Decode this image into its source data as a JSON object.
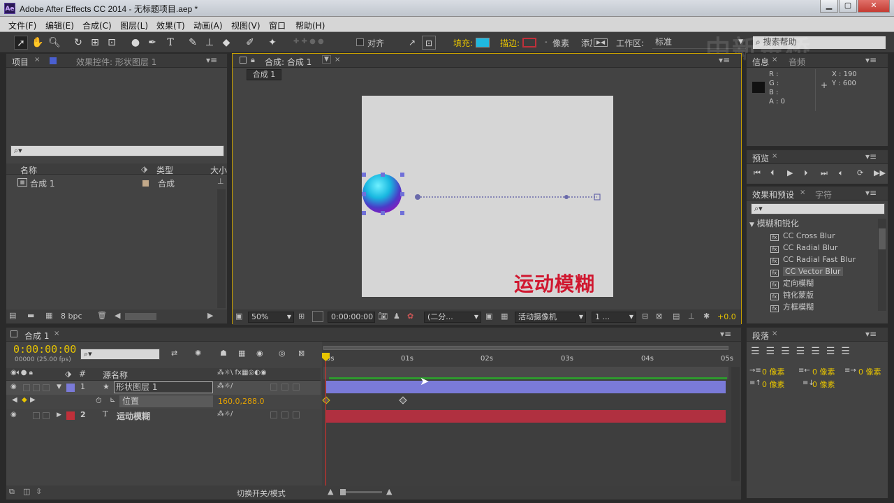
{
  "window": {
    "logo": "Ae",
    "title": "Adobe After Effects CC 2014 - 无标题项目.aep *",
    "min": "▁",
    "max": "▢",
    "close": "✕"
  },
  "menu": [
    "文件(F)",
    "编辑(E)",
    "合成(C)",
    "图层(L)",
    "效果(T)",
    "动画(A)",
    "视图(V)",
    "窗口",
    "帮助(H)"
  ],
  "toolbar": {
    "align_label": "对齐",
    "fill_label": "填充:",
    "stroke_label": "描边:",
    "stroke_unit": "像素",
    "add_label": "添加:",
    "workspace_label": "工作区:",
    "workspace_value": "标准",
    "search_placeholder": "搜索帮助",
    "fill_color": "#1fb8e0",
    "stroke_color": "#c0303a"
  },
  "project_panel": {
    "tab_project": "项目",
    "tab_effect_controls": "效果控件: 形状图层 1",
    "search_placeholder": "⌕▾",
    "col_name": "名称",
    "col_type": "类型",
    "col_size": "大小",
    "items": [
      {
        "name": "合成 1",
        "type": "合成"
      }
    ],
    "bpc": "8 bpc"
  },
  "comp_viewer": {
    "tab_label": "合成: 合成 1",
    "breadcrumb": "合成 1",
    "text_layer": "运动模糊",
    "zoom": "50%",
    "timecode": "0:00:00:00",
    "resolution": "(二分...",
    "camera": "活动摄像机",
    "views": "1 ...",
    "exposure": "+0.0",
    "canvas_color": "#d6d6d6"
  },
  "info_panel": {
    "tab_info": "信息",
    "tab_audio": "音频",
    "r": "R :",
    "g": "G :",
    "b": "B :",
    "a": "A : 0",
    "x": "X : 190",
    "y": "Y : 600"
  },
  "preview_panel": {
    "tab": "预览"
  },
  "effects_panel": {
    "tab_effects": "效果和预设",
    "tab_char": "字符",
    "category": "模糊和锐化",
    "items": [
      "CC Cross Blur",
      "CC Radial Blur",
      "CC Radial Fast Blur",
      "CC Vector Blur",
      "定向模糊",
      "钝化蒙版",
      "方框模糊"
    ],
    "selected_index": 3
  },
  "paragraph_panel": {
    "tab": "段落",
    "indent1": "0 像素",
    "indent2": "0 像素",
    "indent3": "0 像素",
    "space1": "0 像素",
    "space2": "0 像素"
  },
  "timeline": {
    "tab": "合成 1",
    "timecode": "0:00:00:00",
    "fps": "00000 (25.00 fps)",
    "search_placeholder": "⌕▾",
    "col_source": "源名称",
    "col_hash": "#",
    "ruler": [
      "0s",
      "01s",
      "02s",
      "03s",
      "04s",
      "05s"
    ],
    "layers": [
      {
        "num": "1",
        "name": "形状图层 1",
        "color": "#7a7ad8"
      },
      {
        "num": "2",
        "name": "运动模糊",
        "color": "#c0303a"
      }
    ],
    "prop_name": "位置",
    "prop_value": "160.0,288.0",
    "toggle_label": "切换开关/模式"
  },
  "watermark": "中新金桥"
}
